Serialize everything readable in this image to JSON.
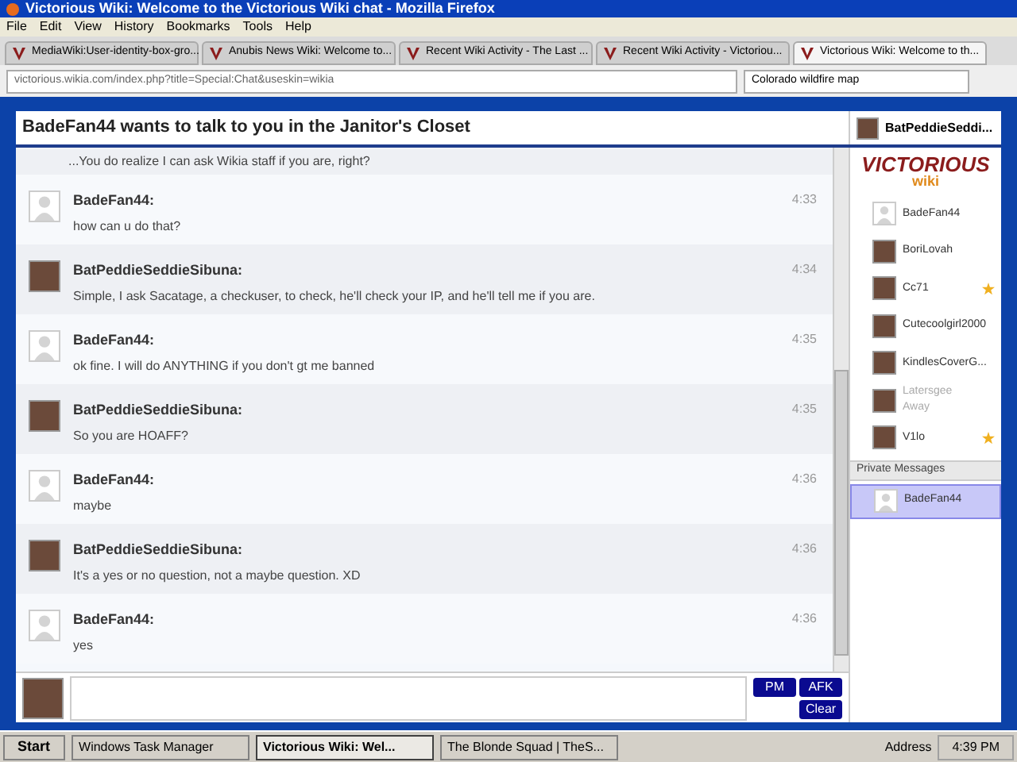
{
  "window": {
    "title": "Victorious Wiki: Welcome to the Victorious Wiki chat - Mozilla Firefox"
  },
  "menu": [
    "File",
    "Edit",
    "View",
    "History",
    "Bookmarks",
    "Tools",
    "Help"
  ],
  "tabs": [
    {
      "label": "MediaWiki:User-identity-box-gro...",
      "selected": false
    },
    {
      "label": "Anubis News Wiki: Welcome to...",
      "selected": false
    },
    {
      "label": "Recent Wiki Activity - The Last ...",
      "selected": false
    },
    {
      "label": "Recent Wiki Activity - Victoriou...",
      "selected": false
    },
    {
      "label": "Victorious Wiki: Welcome to th...",
      "selected": true
    }
  ],
  "address": "victorious.wikia.com/index.php?title=Special:Chat&useskin=wikia",
  "search": {
    "value": "Colorado wildfire map"
  },
  "chat": {
    "header": "BadeFan44 wants to talk to you in the Janitor's Closet",
    "partial": "...You do realize I can ask Wikia staff if you are, right?",
    "messages": [
      {
        "user": "BadeFan44:",
        "text": "how can u do that?",
        "time": "4:33",
        "photo": false
      },
      {
        "user": "BatPeddieSeddieSibuna:",
        "text": "Simple, I ask Sacatage, a checkuser, to check, he'll check your IP, and he'll tell me if you are.",
        "time": "4:34",
        "photo": true
      },
      {
        "user": "BadeFan44:",
        "text": "ok fine. I will do ANYTHING if you don't gt me banned",
        "time": "4:35",
        "photo": false
      },
      {
        "user": "BatPeddieSeddieSibuna:",
        "text": "So you are HOAFF?",
        "time": "4:35",
        "photo": true
      },
      {
        "user": "BadeFan44:",
        "text": "maybe",
        "time": "4:36",
        "photo": false
      },
      {
        "user": "BatPeddieSeddieSibuna:",
        "text": "It's a yes or no question, not a maybe question. XD",
        "time": "4:36",
        "photo": true
      },
      {
        "user": "BadeFan44:",
        "text": "yes",
        "time": "4:36",
        "photo": false
      }
    ],
    "buttons": [
      "PM",
      "AFK",
      "Clear"
    ]
  },
  "sidebar": {
    "me": "BatPeddieSeddi...",
    "logo": "VICTORIOUS",
    "logo_sub": "wiki",
    "users": [
      {
        "name": "BadeFan44",
        "photo": false,
        "star": false
      },
      {
        "name": "BoriLovah",
        "photo": true,
        "star": false
      },
      {
        "name": "Cc71",
        "photo": true,
        "star": true
      },
      {
        "name": "Cutecoolgirl2000",
        "photo": true,
        "star": false
      },
      {
        "name": "KindlesCoverG...",
        "photo": true,
        "star": false
      },
      {
        "name": "Latersgee",
        "status": "Away",
        "photo": true,
        "star": false
      },
      {
        "name": "V1lo",
        "photo": true,
        "star": true
      }
    ],
    "private_header": "Private Messages",
    "private": [
      {
        "name": "BadeFan44",
        "selected": true
      }
    ]
  },
  "taskbar": {
    "start": "Start",
    "items": [
      {
        "label": "Windows Task Manager",
        "selected": false
      },
      {
        "label": "Victorious Wiki: Wel...",
        "selected": true
      },
      {
        "label": "The Blonde Squad | TheS...",
        "selected": false
      }
    ],
    "address": "Address",
    "clock": "4:39 PM"
  }
}
